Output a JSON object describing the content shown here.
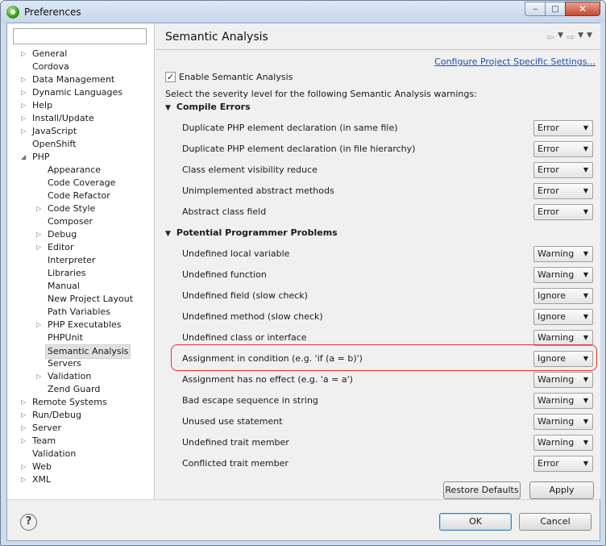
{
  "window": {
    "title": "Preferences",
    "minimize": "‒",
    "maximize": "□",
    "close": "✕"
  },
  "tree": [
    {
      "label": "General",
      "level": 0,
      "twisty": true
    },
    {
      "label": "Cordova",
      "level": 0,
      "twisty": false
    },
    {
      "label": "Data Management",
      "level": 0,
      "twisty": true
    },
    {
      "label": "Dynamic Languages",
      "level": 0,
      "twisty": true
    },
    {
      "label": "Help",
      "level": 0,
      "twisty": true
    },
    {
      "label": "Install/Update",
      "level": 0,
      "twisty": true
    },
    {
      "label": "JavaScript",
      "level": 0,
      "twisty": true
    },
    {
      "label": "OpenShift",
      "level": 0,
      "twisty": false
    },
    {
      "label": "PHP",
      "level": 0,
      "twisty": true,
      "expanded": true
    },
    {
      "label": "Appearance",
      "level": 1,
      "twisty": false
    },
    {
      "label": "Code Coverage",
      "level": 1,
      "twisty": false
    },
    {
      "label": "Code Refactor",
      "level": 1,
      "twisty": false
    },
    {
      "label": "Code Style",
      "level": 1,
      "twisty": true
    },
    {
      "label": "Composer",
      "level": 1,
      "twisty": false
    },
    {
      "label": "Debug",
      "level": 1,
      "twisty": true
    },
    {
      "label": "Editor",
      "level": 1,
      "twisty": true
    },
    {
      "label": "Interpreter",
      "level": 1,
      "twisty": false
    },
    {
      "label": "Libraries",
      "level": 1,
      "twisty": false
    },
    {
      "label": "Manual",
      "level": 1,
      "twisty": false
    },
    {
      "label": "New Project Layout",
      "level": 1,
      "twisty": false
    },
    {
      "label": "Path Variables",
      "level": 1,
      "twisty": false
    },
    {
      "label": "PHP Executables",
      "level": 1,
      "twisty": true
    },
    {
      "label": "PHPUnit",
      "level": 1,
      "twisty": false
    },
    {
      "label": "Semantic Analysis",
      "level": 1,
      "twisty": false,
      "selected": true
    },
    {
      "label": "Servers",
      "level": 1,
      "twisty": false
    },
    {
      "label": "Validation",
      "level": 1,
      "twisty": true
    },
    {
      "label": "Zend Guard",
      "level": 1,
      "twisty": false
    },
    {
      "label": "Remote Systems",
      "level": 0,
      "twisty": true
    },
    {
      "label": "Run/Debug",
      "level": 0,
      "twisty": true
    },
    {
      "label": "Server",
      "level": 0,
      "twisty": true
    },
    {
      "label": "Team",
      "level": 0,
      "twisty": true
    },
    {
      "label": "Validation",
      "level": 0,
      "twisty": false
    },
    {
      "label": "Web",
      "level": 0,
      "twisty": true
    },
    {
      "label": "XML",
      "level": 0,
      "twisty": true
    }
  ],
  "page": {
    "title": "Semantic Analysis",
    "configure_link": "Configure Project Specific Settings...",
    "enable_label": "Enable Semantic Analysis",
    "enable_checked": true,
    "description": "Select the severity level for the following Semantic Analysis warnings:"
  },
  "sections": [
    {
      "title": "Compile Errors",
      "rows": [
        {
          "label": "Duplicate PHP element declaration (in same file)",
          "value": "Error"
        },
        {
          "label": "Duplicate PHP element declaration (in file hierarchy)",
          "value": "Error"
        },
        {
          "label": "Class element visibility reduce",
          "value": "Error"
        },
        {
          "label": "Unimplemented abstract methods",
          "value": "Error"
        },
        {
          "label": "Abstract class field",
          "value": "Error"
        }
      ]
    },
    {
      "title": "Potential Programmer Problems",
      "rows": [
        {
          "label": "Undefined local variable",
          "value": "Warning"
        },
        {
          "label": "Undefined function",
          "value": "Warning"
        },
        {
          "label": "Undefined field (slow check)",
          "value": "Ignore"
        },
        {
          "label": "Undefined method (slow check)",
          "value": "Ignore"
        },
        {
          "label": "Undefined class or interface",
          "value": "Warning"
        },
        {
          "label": "Assignment in condition (e.g. 'if (a = b)')",
          "value": "Ignore"
        },
        {
          "label": "Assignment has no effect (e.g. 'a = a')",
          "value": "Warning"
        },
        {
          "label": "Bad escape sequence in string",
          "value": "Warning"
        },
        {
          "label": "Unused use statement",
          "value": "Warning"
        },
        {
          "label": "Undefined trait member",
          "value": "Warning"
        },
        {
          "label": "Conflicted trait member",
          "value": "Error"
        }
      ]
    }
  ],
  "buttons": {
    "restore": "Restore Defaults",
    "apply": "Apply",
    "ok": "OK",
    "cancel": "Cancel"
  },
  "help": "?",
  "colors": {
    "highlight": "#d9352f",
    "link": "#1a4fb5"
  }
}
